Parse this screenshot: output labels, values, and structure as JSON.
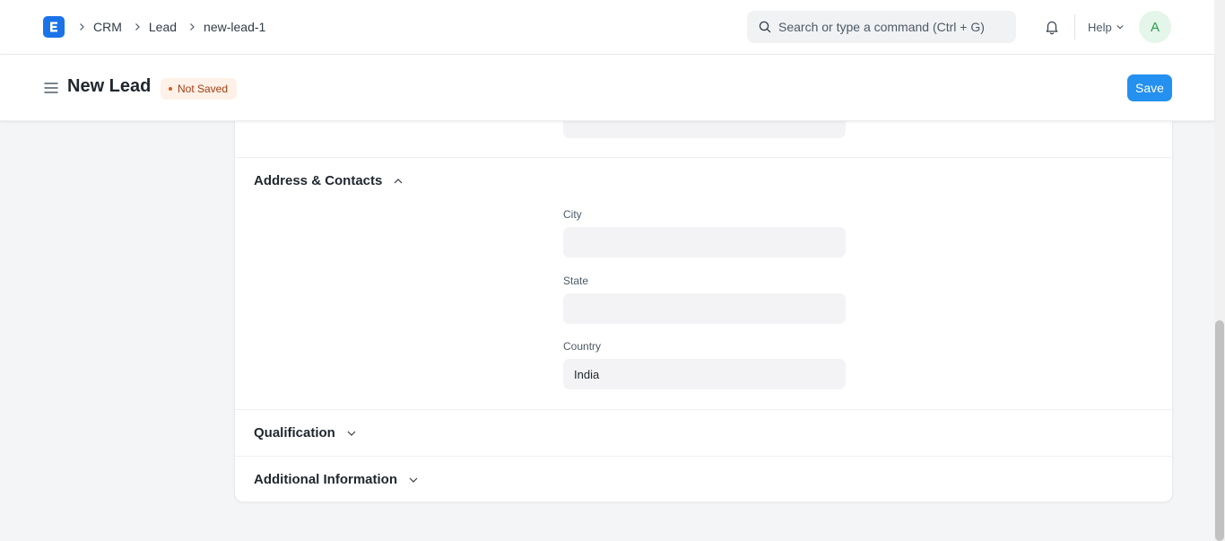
{
  "navbar": {
    "logo_letter": "E",
    "breadcrumb": [
      "CRM",
      "Lead",
      "new-lead-1"
    ],
    "search_placeholder": "Search or type a command (Ctrl + G)",
    "help_label": "Help",
    "avatar_initial": "A"
  },
  "page_head": {
    "title": "New Lead",
    "status": "Not Saved",
    "save_label": "Save"
  },
  "form": {
    "sections": {
      "address": {
        "title": "Address & Contacts",
        "expanded": true,
        "fields": {
          "city": {
            "label": "City",
            "value": ""
          },
          "state": {
            "label": "State",
            "value": ""
          },
          "country": {
            "label": "Country",
            "value": "India"
          }
        }
      },
      "qualification": {
        "title": "Qualification",
        "expanded": false
      },
      "additional": {
        "title": "Additional Information",
        "expanded": false
      }
    }
  },
  "colors": {
    "primary": "#2490ef",
    "logo": "#1a73e8",
    "status_bg": "#fff1e7",
    "status_text": "#a23c11",
    "avatar_bg": "#e4f5e9",
    "avatar_text": "#2d9d4f",
    "page_bg": "#f4f5f6",
    "input_bg": "#f3f3f5"
  },
  "icons": {
    "logo": "app-logo-e",
    "breadcrumb_separator": "chevron-right-icon",
    "search": "search-icon",
    "notifications": "bell-icon",
    "help_dropdown": "chevron-down-icon",
    "sidebar_toggle": "hamburger-icon",
    "section_expanded": "chevron-up-icon",
    "section_collapsed": "chevron-down-icon"
  }
}
